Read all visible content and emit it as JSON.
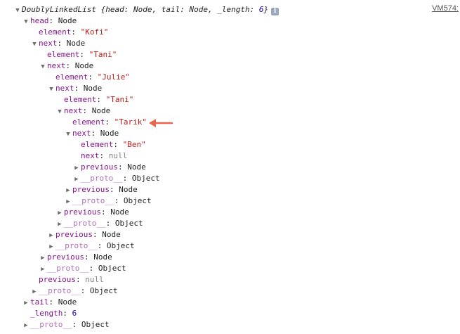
{
  "source_link": "VM574:",
  "info_icon_glyph": "i",
  "summary": {
    "name": "DoublyLinkedList",
    "open": " {",
    "k1": "head",
    "v1": "Node",
    "k2": "tail",
    "v2": "Node",
    "k3": "_length",
    "v3": "6",
    "close": "}"
  },
  "labels": {
    "head": "head",
    "tail": "tail",
    "next": "next",
    "previous": "previous",
    "element": "element",
    "proto": "__proto__",
    "length": "_length",
    "colon": ": ",
    "node": "Node",
    "object": "Object",
    "null": "null"
  },
  "elements": [
    "\"Kofi\"",
    "\"Tani\"",
    "\"Julie\"",
    "\"Tani\"",
    "\"Tarik\"",
    "\"Ben\""
  ],
  "length_value": "6",
  "expander": {
    "expanded": "▼",
    "collapsed": "▶"
  },
  "highlight_color": "#e8654f"
}
